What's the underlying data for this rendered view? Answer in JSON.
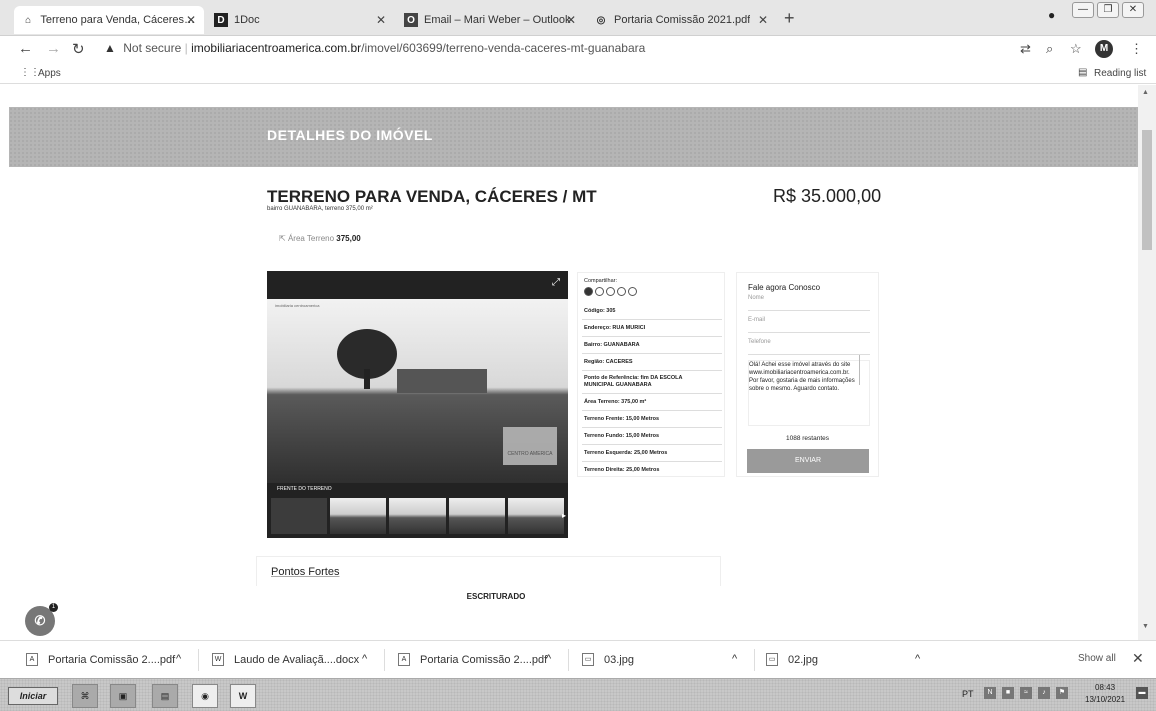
{
  "browser": {
    "tabs": [
      {
        "title": "Terreno para Venda, Cáceres / MT, :",
        "icon": "house-icon"
      },
      {
        "title": "1Doc",
        "icon": "doc-logo-icon"
      },
      {
        "title": "Email – Mari Weber – Outlook",
        "icon": "outlook-icon"
      },
      {
        "title": "Portaria Comissão 2021.pdf",
        "icon": "globe-icon"
      }
    ],
    "address": {
      "security": "Not secure",
      "host": "imobiliariacentroamerica.com.br",
      "path": "/imovel/603699/terreno-venda-caceres-mt-guanabara"
    },
    "avatar_letter": "M",
    "bookmarks_apps": "Apps",
    "reading_list": "Reading list"
  },
  "page": {
    "section_title": "DETALHES DO IMÓVEL",
    "property": {
      "title": "TERRENO PARA VENDA, CÁCERES / MT",
      "subtitle": "bairro GUANABARA, terreno 375,00 m²",
      "price": "R$ 35.000,00",
      "area_label": "Área Terreno",
      "area_value": "375,00"
    },
    "gallery": {
      "caption": "FRENTE DO TERRENO",
      "watermark": "imobiliaria centroamerica",
      "logo_text": "CENTRO AMERICA"
    },
    "info": {
      "share_label": "Compartilhar:",
      "rows": [
        "Código: 305",
        "Endereço: RUA MURICI",
        "Bairro: GUANABARA",
        "Região: CACERES",
        "Ponto de Referência: fim DA ESCOLA MUNICIPAL GUANABARA",
        "Área Terreno: 375,00 m²",
        "Terreno Frente: 15,00 Metros",
        "Terreno Fundo: 15,00 Metros",
        "Terreno Esquerda: 25,00 Metros",
        "Terreno Direita: 25,00 Metros"
      ]
    },
    "contact": {
      "title": "Fale agora Conosco",
      "name_placeholder": "Nome",
      "email_placeholder": "E-mail",
      "phone_placeholder": "Telefone",
      "message": "Olá! Achei esse imóvel através do site www.imobiliariacentroamerica.com.br. Por favor, gostaria de mais informações sobre o mesmo. Aguardo contato.",
      "char_count": "1088 restantes",
      "send_label": "ENVIAR"
    },
    "highlights_title": "Pontos Fortes",
    "highlight_item": "ESCRITURADO"
  },
  "downloads": {
    "items": [
      {
        "name": "Portaria Comissão 2....pdf",
        "icon": "pdf-file-icon"
      },
      {
        "name": "Laudo de Avaliaçã....docx",
        "icon": "word-file-icon"
      },
      {
        "name": "Portaria Comissão 2....pdf",
        "icon": "pdf-file-icon"
      },
      {
        "name": "03.jpg",
        "icon": "image-file-icon"
      },
      {
        "name": "02.jpg",
        "icon": "image-file-icon"
      }
    ],
    "show_all": "Show all"
  },
  "taskbar": {
    "start_label": "Iniciar",
    "language": "PT",
    "time": "08:43",
    "date": "13/10/2021"
  }
}
